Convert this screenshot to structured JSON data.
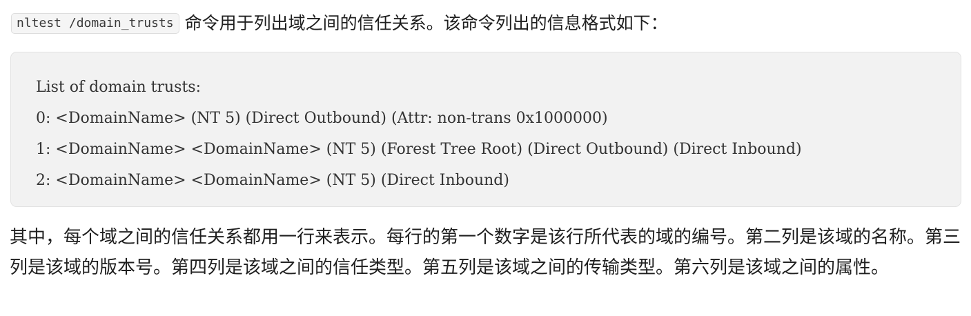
{
  "intro": {
    "command": "nltest /domain_trusts",
    "text": "命令用于列出域之间的信任关系。该命令列出的信息格式如下："
  },
  "code_block": {
    "lines": [
      "List of domain trusts:",
      "0: <DomainName> (NT 5) (Direct Outbound) (Attr: non-trans 0x1000000)",
      "1: <DomainName> <DomainName> (NT 5) (Forest Tree Root) (Direct Outbound) (Direct Inbound)",
      "2: <DomainName> <DomainName> (NT 5) (Direct Inbound)"
    ]
  },
  "paragraph": {
    "text": "其中，每个域之间的信任关系都用一行来表示。每行的第一个数字是该行所代表的域的编号。第二列是该域的名称。第三列是该域的版本号。第四列是该域之间的信任类型。第五列是该域之间的传输类型。第六列是该域之间的属性。"
  }
}
